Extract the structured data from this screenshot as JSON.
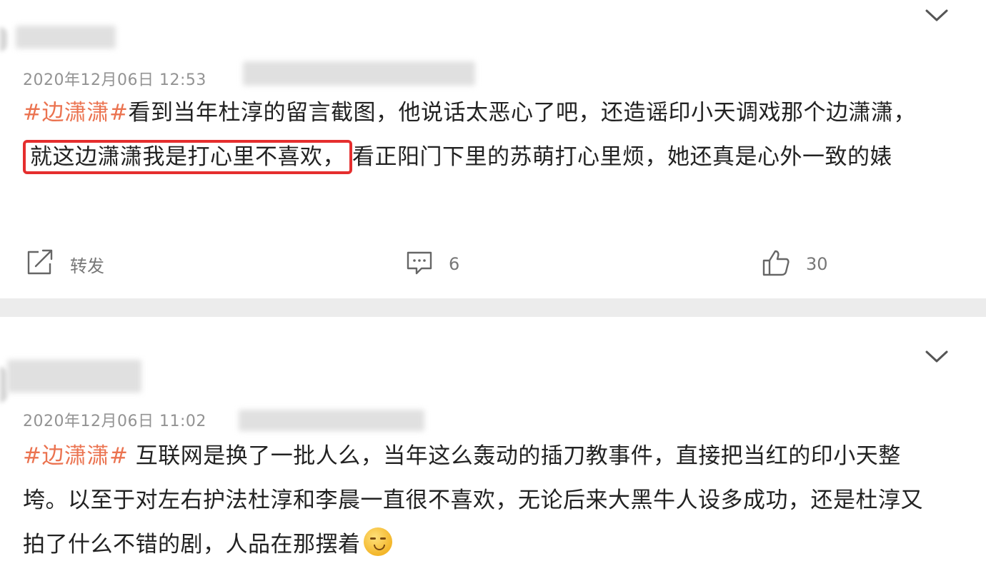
{
  "comments": [
    {
      "time": "2020年12月06日 12:53",
      "topic": "#边潇潇#",
      "text_before": "看到当年杜淳的留言截图，他说话太恶心了吧，还造谣印小天调戏那个边潇潇，",
      "text_highlight": "就这边潇潇我是打心里不喜欢，",
      "text_after": "看正阳门下里的苏萌打心里烦，她还真是心外一致的婊",
      "repost_label": "转发",
      "comment_count": "6",
      "like_count": "30"
    },
    {
      "time": "2020年12月06日 11:02",
      "topic": "#边潇潇#",
      "text": " 互联网是换了一批人么，当年这么轰动的插刀教事件，直接把当红的印小天整垮。以至于对左右护法杜淳和李晨一直很不喜欢，无论后来大黑牛人设多成功，还是杜淳又拍了什么不错的剧，人品在那摆着",
      "emoji": "shush-face-emoji"
    }
  ],
  "colors": {
    "topic": "#eb7350",
    "highlight_border": "#e52e2e",
    "meta_text": "#939393",
    "page_bg": "#ececec"
  },
  "icons": {
    "expand": "chevron-down-icon",
    "repost": "share-icon",
    "comment": "comment-icon",
    "like": "thumbs-up-icon"
  }
}
